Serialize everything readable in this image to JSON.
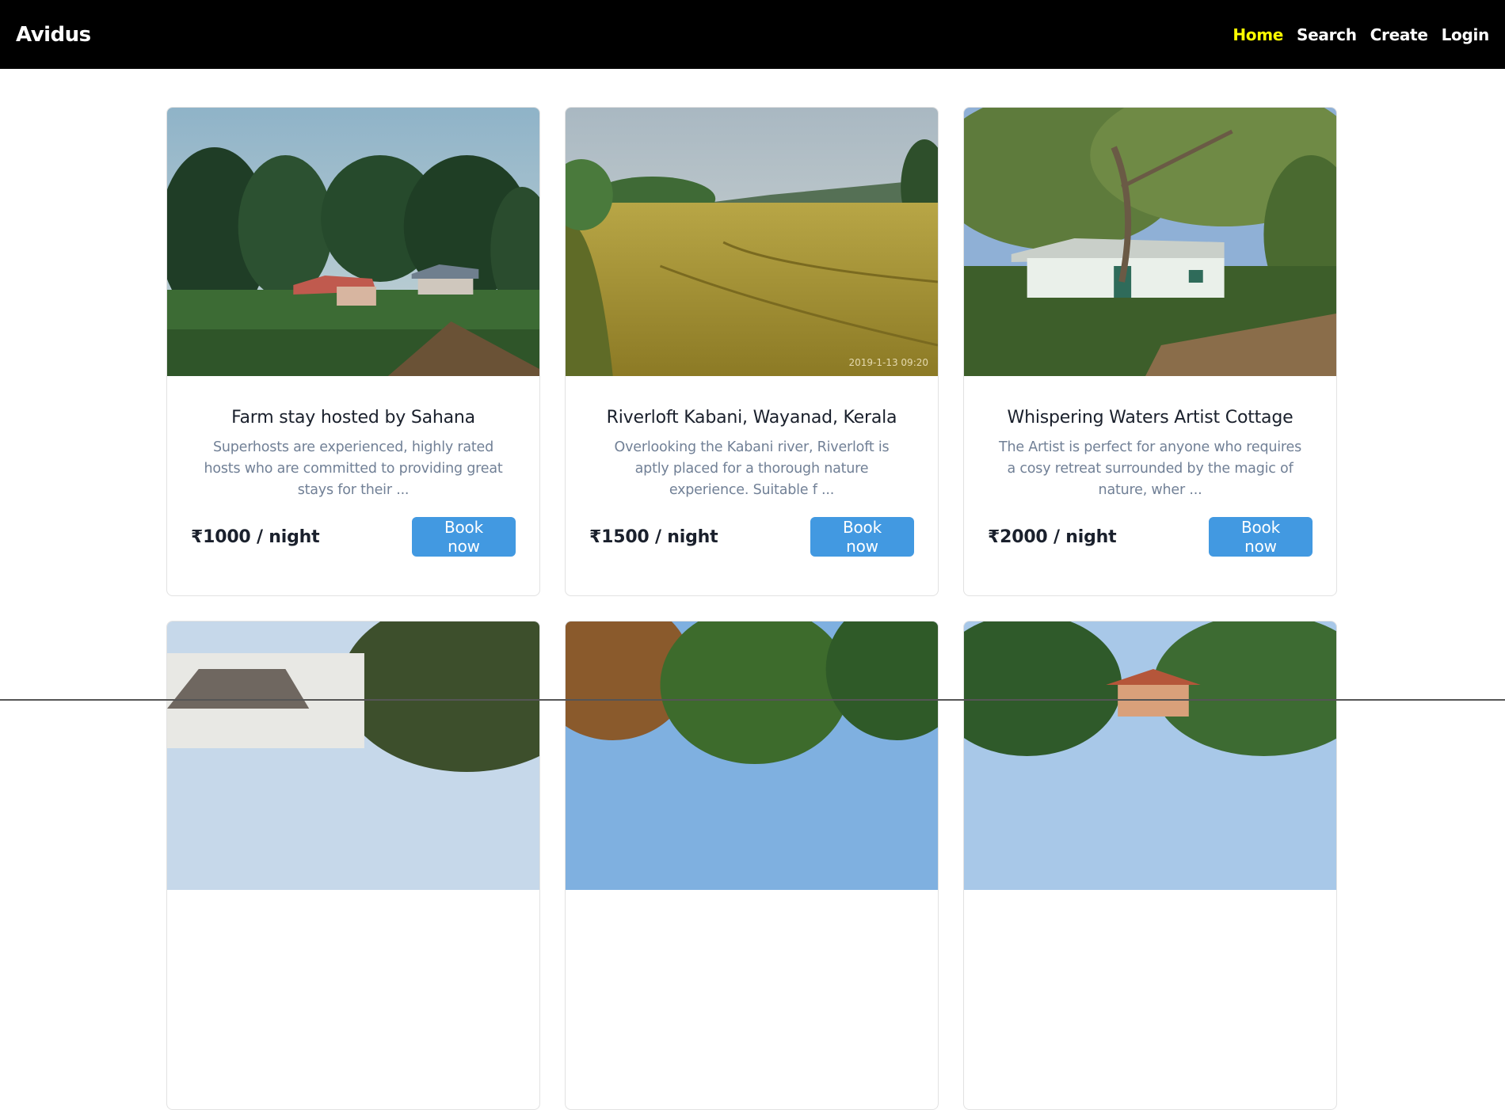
{
  "navbar": {
    "brand": "Avidus",
    "links": [
      {
        "label": "Home",
        "active": true
      },
      {
        "label": "Search",
        "active": false
      },
      {
        "label": "Create",
        "active": false
      },
      {
        "label": "Login",
        "active": false
      }
    ],
    "active_color": "#ffff00"
  },
  "listings": [
    {
      "title": "Farm stay hosted by Sahana",
      "description": "Superhosts are experienced, highly rated hosts who are committed to providing great stays for their ...",
      "price": "₹1000 / night",
      "button": "Book now",
      "image": "farm-house-forest"
    },
    {
      "title": "Riverloft Kabani, Wayanad, Kerala",
      "description": "Overlooking the Kabani river, Riverloft is aptly placed for a thorough nature experience. Suitable f ...",
      "price": "₹1500 / night",
      "button": "Book now",
      "image": "paddy-field",
      "image_stamp": "2019-1-13 09:20"
    },
    {
      "title": "Whispering Waters Artist Cottage",
      "description": "The Artist is perfect for anyone who requires a cosy retreat surrounded by the magic of nature, wher ...",
      "price": "₹2000 / night",
      "button": "Book now",
      "image": "white-cottage-trees"
    },
    {
      "image": "house-roof-trees"
    },
    {
      "image": "palm-trees"
    },
    {
      "image": "red-roof-house"
    }
  ],
  "colors": {
    "button": "#4299e1",
    "title": "#1a202c",
    "description": "#718096"
  }
}
